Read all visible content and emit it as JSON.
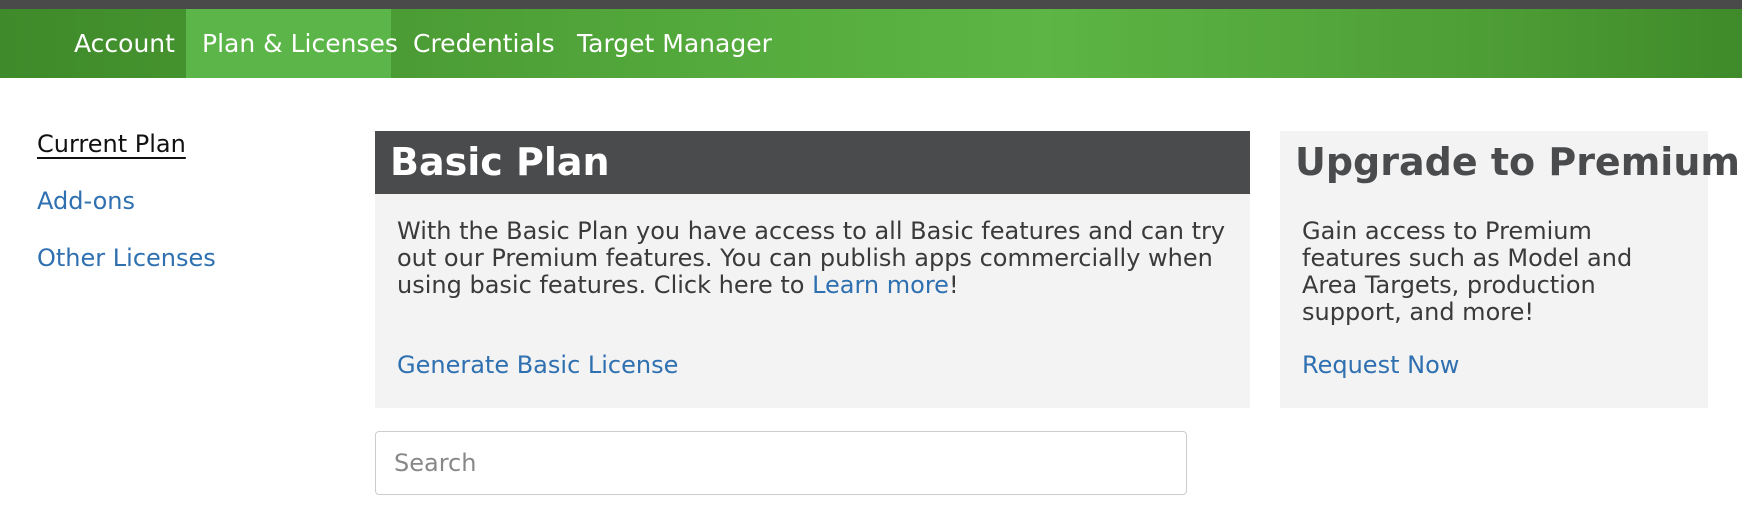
{
  "nav": {
    "items": [
      {
        "label": "Account"
      },
      {
        "label": "Plan & Licenses"
      },
      {
        "label": "Credentials"
      },
      {
        "label": "Target Manager"
      }
    ]
  },
  "sidebar": {
    "items": [
      {
        "label": "Current Plan"
      },
      {
        "label": "Add-ons"
      },
      {
        "label": "Other Licenses"
      }
    ]
  },
  "basic_plan": {
    "title": "Basic Plan",
    "description": "With the Basic Plan you have access to all Basic features and can try out our Premium features. You can publish apps commercially when using basic features. Click here to ",
    "learn_more": "Learn more",
    "description_end": "!",
    "action": "Generate Basic License"
  },
  "premium": {
    "title": "Upgrade to Premium",
    "description": "Gain access to Premium features such as Model and Area Targets, production support, and more!",
    "action": "Request Now"
  },
  "search": {
    "placeholder": "Search"
  }
}
